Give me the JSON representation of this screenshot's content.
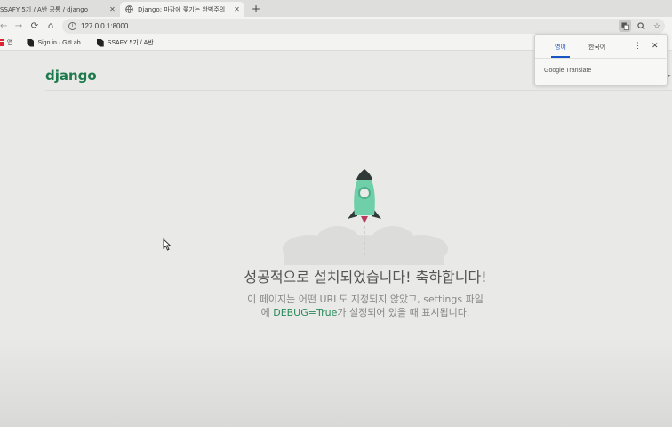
{
  "tabs": [
    {
      "title": "SSAFY 5기 / A반 공통 / django",
      "active": false
    },
    {
      "title": "Django: 마감에 쫓기는 완벽주의",
      "active": true
    }
  ],
  "toolbar": {
    "url": "127.0.0.1:8000"
  },
  "bookmarks": [
    {
      "label": "앱",
      "icon": "apps-icon"
    },
    {
      "label": "Sign in · GitLab",
      "icon": "gitlab-icon"
    },
    {
      "label": "SSAFY 5기 / A반...",
      "icon": "gitlab-icon"
    }
  ],
  "page": {
    "logo": "django",
    "headline": "성공적으로 설치되었습니다! 축하합니다!",
    "desc_line1": "이 페이지는 어떤 URL도 지정되지 않았고, settings 파일",
    "desc_line2_prefix": "에 ",
    "desc_line2_code": "DEBUG=True",
    "desc_line2_suffix": "가 설정되어 있을 때 표시됩니다."
  },
  "translate_popup": {
    "tab_source": "영어",
    "tab_target": "한국어",
    "brand": "Google Translate"
  },
  "edge_text": "노",
  "colors": {
    "django_green": "#1e7a4c",
    "link_green": "#2a8a5a",
    "translate_blue": "#1a55c4"
  }
}
